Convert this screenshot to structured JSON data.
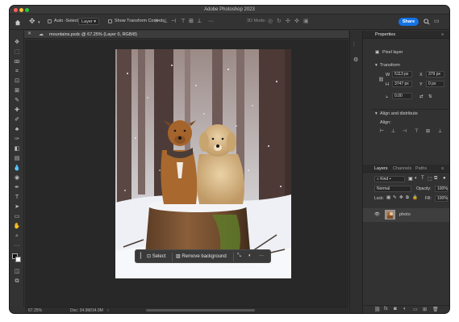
{
  "app": {
    "window_title": "Adobe Photoshop 2023",
    "traffic_colors": [
      "#ff5f57",
      "#febc2e",
      "#28c840"
    ]
  },
  "options_bar": {
    "auto_select_label": "Auto -Select:",
    "auto_select_value": "Layer",
    "show_transform_label": "Show Transform Controls",
    "mode_3d_label": "3D Mode:",
    "more_label": "···",
    "share_label": "Share",
    "accent_color": "#1473e6"
  },
  "document": {
    "tab_title": "mountains.psdc @ 67.25% (Layer 0, RGB/8)"
  },
  "taskbar": {
    "select_label": "Select",
    "remove_bg_label": "Remove background",
    "more_label": "···"
  },
  "status": {
    "zoom": "67.25%",
    "doc_size": "Doc: 34.9M/34.9M"
  },
  "properties": {
    "tab_label": "Properties",
    "layer_kind": "Pixel layer",
    "transform_title": "Transform",
    "w_label": "W",
    "w_value": "5113 px",
    "h_label": "H",
    "h_value": "3747 px",
    "x_label": "X",
    "x_value": "379 px",
    "y_label": "Y",
    "y_value": "0 px",
    "angle_value": "0.00",
    "align_title": "Align and distribute",
    "align_label": "Align:"
  },
  "layers": {
    "tabs": [
      "Layers",
      "Channels",
      "Paths"
    ],
    "kind_label": "Kind",
    "blend_mode": "Normal",
    "opacity_label": "Opacity:",
    "opacity_value": "100%",
    "lock_label": "Lock:",
    "fill_label": "Fill:",
    "fill_value": "100%",
    "items": [
      {
        "name": "photo"
      }
    ]
  }
}
